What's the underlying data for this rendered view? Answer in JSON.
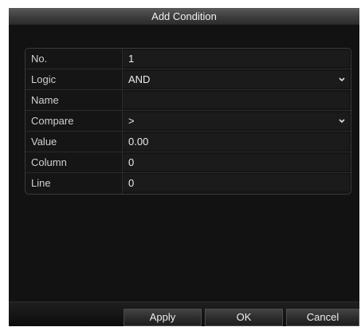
{
  "dialog": {
    "title": "Add Condition"
  },
  "form": {
    "rows": [
      {
        "label": "No.",
        "value": "1"
      },
      {
        "label": "Logic",
        "value": "AND",
        "dropdown": true
      },
      {
        "label": "Name",
        "value": ""
      },
      {
        "label": "Compare",
        "value": ">",
        "dropdown": true
      },
      {
        "label": "Value",
        "value": "0.00"
      },
      {
        "label": "Column",
        "value": "0"
      },
      {
        "label": "Line",
        "value": "0"
      }
    ]
  },
  "buttons": {
    "apply": "Apply",
    "ok": "OK",
    "cancel": "Cancel"
  },
  "icons": {
    "dropdown": "chevron-down-icon"
  }
}
